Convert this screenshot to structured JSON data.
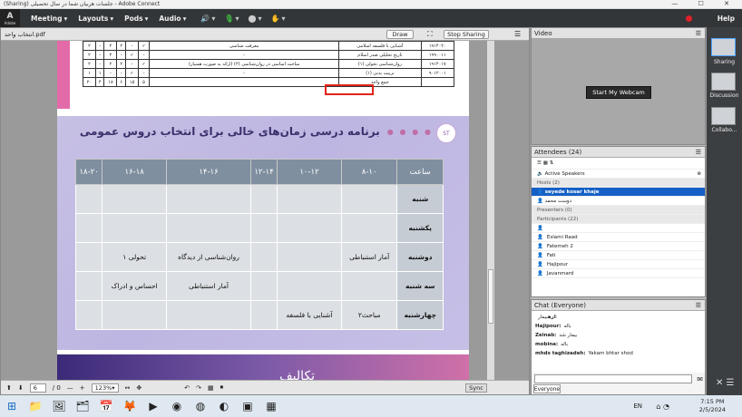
{
  "window": {
    "title": "(Sharing) جلسات هربیان شما در سال تحصیلی - Adobe Connect",
    "controls": "— ☐ ✕"
  },
  "menu": {
    "logo": "A",
    "logo_sub": "Adobe",
    "items": [
      "Meeting",
      "Layouts",
      "Pods",
      "Audio"
    ],
    "help": "Help"
  },
  "doc": {
    "filename": "انتخاب واحد.pdf",
    "draw": "Draw",
    "stop_sharing": "Stop Sharing",
    "table1": [
      [
        "۱۹۱۴۰۲۰",
        "آشنایی با فلسفه اسلامی",
        "معرفت شناسی",
        "✓",
        "-",
        "۲",
        "۲",
        "-",
        "۲"
      ],
      [
        "۱۹۹۰۰۱۱",
        "تاریخ تحلیلی صدر اسلام",
        "-",
        "-",
        "✓",
        "-",
        "۲",
        "-",
        "۲"
      ],
      [
        "۱۹۱۴۰۱۷",
        "روان‌شناسی تحولی (۱)",
        "مباحث اساسی در روان‌شناسی (۲) (ارائه به صورت همنیاز)",
        "✓",
        "-",
        "۲",
        "۲",
        "-",
        "۲"
      ],
      [
        "۹۰۱۲۰۰۱",
        "تربیت بدنی (۱)",
        "-",
        "-",
        "✓",
        "-",
        "-",
        "۱",
        "۱"
      ],
      [
        "",
        "جمع واحد",
        "",
        "۵",
        "۱۵",
        "۶",
        "۱۸",
        "۴",
        "۲۰"
      ]
    ],
    "slide_title": "برنامه درسی  زمان‌های خالی برای انتخاب دروس عمومی",
    "slide_logo": "ST",
    "schedule": {
      "header_day": "ساعت",
      "times": [
        "۸-۱۰",
        "۱۰-۱۲",
        "۱۲-۱۴",
        "۱۴-۱۶",
        "۱۶-۱۸",
        "۱۸-۲۰"
      ],
      "rows": [
        {
          "day": "شنبه",
          "cells": [
            "",
            "",
            "",
            "",
            "",
            ""
          ]
        },
        {
          "day": "یکشنبه",
          "cells": [
            "",
            "",
            "",
            "",
            "",
            ""
          ]
        },
        {
          "day": "دوشنبه",
          "cells": [
            "آمار استنباطی",
            "",
            "",
            "روان‌شناسی از دیدگاه",
            "تحولی ۱",
            ""
          ]
        },
        {
          "day": "سه شنبه",
          "cells": [
            "",
            "",
            "",
            "آمار استنباطی",
            "احساس و ادراک",
            ""
          ]
        },
        {
          "day": "چهارشنبه",
          "cells": [
            "مباحث۲",
            "آشنایی با فلسفه",
            "",
            "",
            "",
            ""
          ]
        }
      ]
    },
    "slide2_title": "تکالیف",
    "page_current": "6",
    "page_total": "/ 0",
    "zoom": "123%",
    "sync": "Sync"
  },
  "video": {
    "title": "Video",
    "webcam_button": "Start My Webcam"
  },
  "attendees": {
    "title": "Attendees",
    "count": "(24)",
    "active_speakers": "Active Speakers",
    "hosts_header": "Hosts (2)",
    "hosts": [
      "seyede kosar khaje",
      "دوست محمد"
    ],
    "presenters_header": "Presenters (0)",
    "participants_header": "Participants (22)",
    "participants": [
      "",
      "Eslami Raad",
      "Fatemeh 2",
      "Fati",
      "Hajipour",
      "Javanmard"
    ]
  },
  "chat": {
    "title": "Chat",
    "scope": "(Everyone)",
    "messages": [
      {
        "user": "اره",
        "text": "بیمار:"
      },
      {
        "user": "Hajipour:",
        "text": "باله"
      },
      {
        "user": "Zeinab:",
        "text": "بیمار شد"
      },
      {
        "user": "mobina:",
        "text": "باله"
      },
      {
        "user": "mhds taghizadeh:",
        "text": "Yakam bhtar shod"
      }
    ],
    "tab": "Everyone"
  },
  "sidebar": {
    "items": [
      "Sharing",
      "Discussion",
      "Collabo..."
    ]
  },
  "taskbar": {
    "lang": "EN",
    "time": "7:15 PM",
    "date": "2/5/2024"
  }
}
